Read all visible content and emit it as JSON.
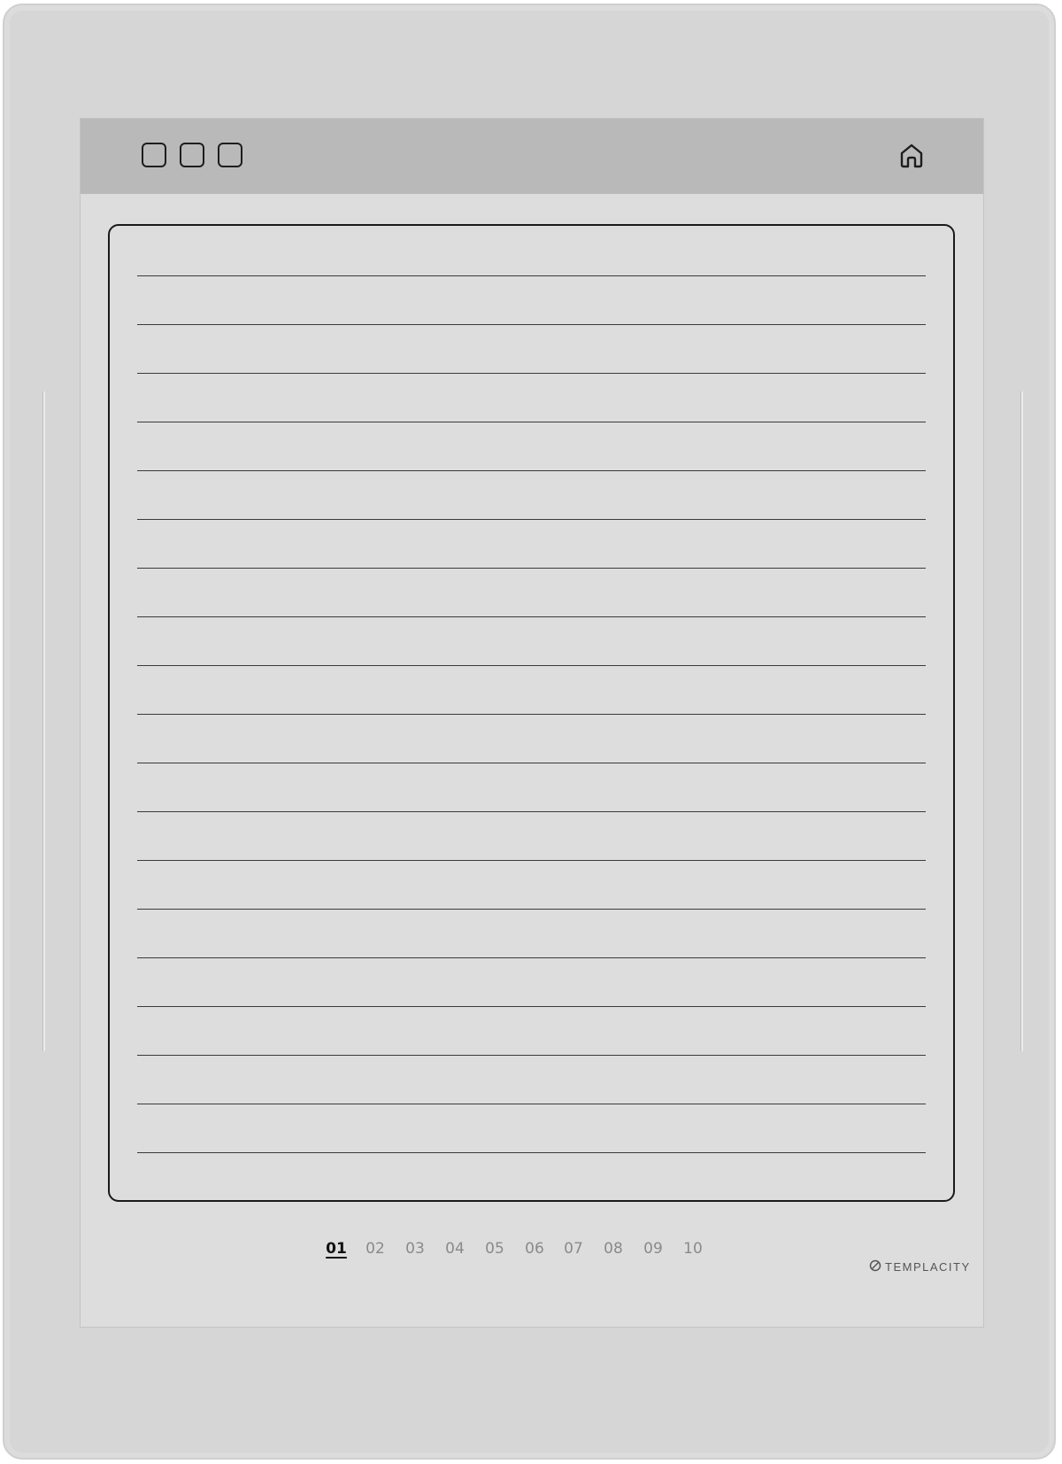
{
  "toolbar": {
    "buttons": [
      "tab-1",
      "tab-2",
      "tab-3"
    ],
    "home_icon": "home-icon"
  },
  "pagination": {
    "pages": [
      "01",
      "02",
      "03",
      "04",
      "05",
      "06",
      "07",
      "08",
      "09",
      "10"
    ],
    "active": "01"
  },
  "brand": {
    "name": "TEMPLACITY",
    "icon": "templacity-logo-icon"
  },
  "colors": {
    "screen_bg": "#dddddd",
    "topbar_bg": "#b9b9b9",
    "ink": "#1a1a1a",
    "inactive_page": "#8a8a8a"
  }
}
